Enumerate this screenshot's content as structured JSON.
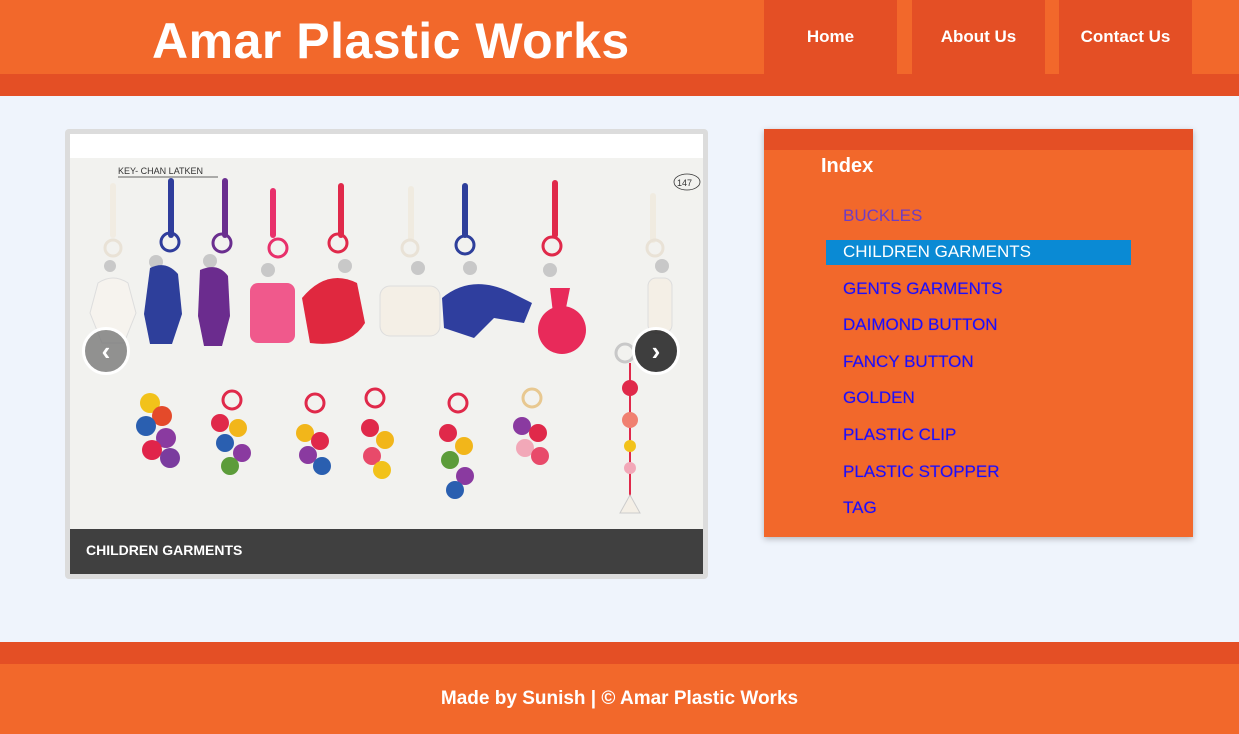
{
  "header": {
    "title": "Amar Plastic Works",
    "nav": {
      "home": "Home",
      "about": "About Us",
      "contact": "Contact Us"
    }
  },
  "slider": {
    "caption": "CHILDREN GARMENTS",
    "prev_icon": "‹",
    "next_icon": "›",
    "photo_labels": {
      "heading": "KEY- CHAN LATKEN",
      "number": "147"
    }
  },
  "index": {
    "title": "Index",
    "items": [
      "BUCKLES",
      "CHILDREN GARMENTS",
      "GENTS GARMENTS",
      "DAIMOND BUTTON",
      "FANCY BUTTON",
      "GOLDEN",
      "PLASTIC CLIP",
      "PLASTIC STOPPER",
      "TAG"
    ],
    "active_index": 1
  },
  "footer": {
    "text": "Made by Sunish | © Amar Plastic Works"
  },
  "colors": {
    "brand_orange": "#f2682b",
    "dark_orange": "#e44f25",
    "active_blue": "#0a8ad4",
    "link_blue": "#1a0dff"
  }
}
